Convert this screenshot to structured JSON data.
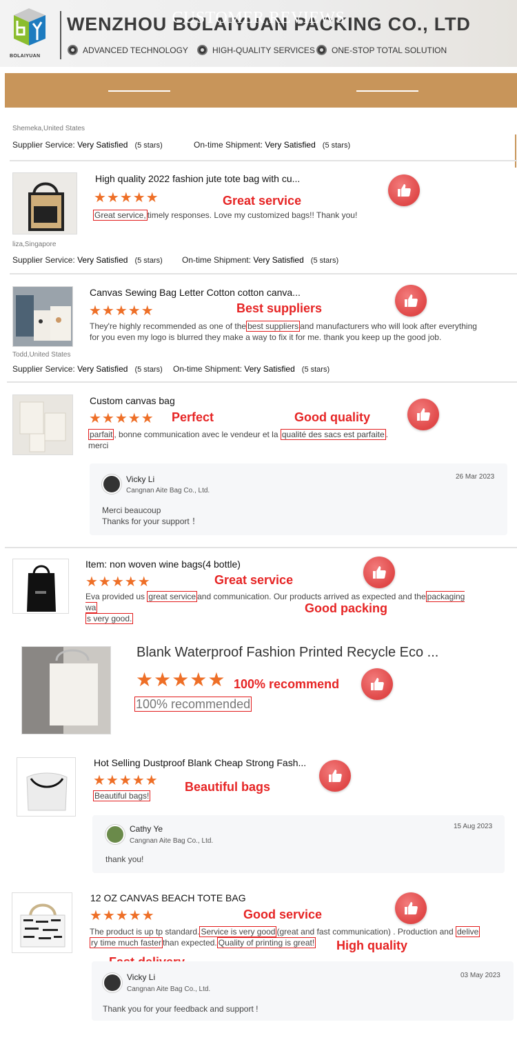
{
  "header": {
    "company_name": "WENZHOU BOLAIYUAN PACKING CO., LTD",
    "logo_text": "BOLAIYUAN",
    "features": [
      "ADVANCED TECHNOLOGY",
      "HIGH-QUALITY SERVICES",
      "ONE-STOP TOTAL SOLUTION"
    ]
  },
  "banner": {
    "title": "CUSTOMER REVIEWS"
  },
  "colors": {
    "banner": "#c8955a",
    "star": "#ee6f27",
    "red_label": "#e62424",
    "thumb": "#e04848"
  },
  "icons": {
    "like": "thumbs-up-icon",
    "star": "star-icon",
    "avatar": "avatar"
  },
  "service_labels": {
    "supplier": "Supplier Service:",
    "ontime": "On-time Shipment:",
    "very_satisfied": "Very Satisfied",
    "five_stars": "(5 stars)"
  },
  "review0": {
    "reviewer": "Shemeka,United States"
  },
  "review1": {
    "title": "High quality 2022 fashion jute tote bag with cu...",
    "stars": "★★★★★",
    "label": "Great service",
    "hl": "Great service,",
    "text_rest": "timely responses. Love my customized bags!! Thank you!",
    "reviewer": "liza,Singapore"
  },
  "review2": {
    "title": "Canvas Sewing Bag Letter Cotton cotton canva...",
    "stars": "★★★★★",
    "label": "Best suppliers",
    "text_pre": "They're highly recommended as one of the",
    "hl": "best suppliers",
    "text_post": "and manufacturers who will look after everything",
    "text_line2": "for you even my logo is blurred they make a way to fix it for me. thank you keep up the good job.",
    "reviewer": "Todd,United States"
  },
  "review3": {
    "title": "Custom canvas bag",
    "stars": "★★★★★",
    "label1": "Perfect",
    "label2": "Good quality",
    "hl1": "parfait",
    "text_mid": ", bonne communication  avec le vendeur et la",
    "hl2": "qualité des sacs  est parfaite",
    "text_end": ".",
    "text_line2": "merci",
    "reply": {
      "name": "Vicky Li",
      "company": "Cangnan Aite Bag Co., Ltd.",
      "date": "26 Mar 2023",
      "line1": "Merci  beaucoup",
      "line2": "Thanks for your support  ！"
    }
  },
  "review4": {
    "title": "Item: non woven wine bags(4 bottle)",
    "stars": "★★★★★",
    "label1": "Great service",
    "label2": "Good packing",
    "text_pre": "Eva provided us",
    "hl1": "great service",
    "text_mid": "and communication. Our products arrived as expected and the",
    "hl2a": "packaging wa",
    "hl2b": "s very good."
  },
  "review5": {
    "title": "Blank Waterproof Fashion Printed Recycle Eco ...",
    "stars": "★★★★★",
    "label": "100% recommend",
    "hl": "100% recommended"
  },
  "review6": {
    "title": "Hot Selling Dustproof Blank Cheap Strong Fash...",
    "stars": "★★★★★",
    "label": "Beautiful bags",
    "hl": "Beautiful bags!",
    "reply": {
      "name": "Cathy Ye",
      "company": "Cangnan Aite Bag Co., Ltd.",
      "date": "15 Aug 2023",
      "line1": "thank you!"
    }
  },
  "review7": {
    "title": "12 OZ CANVAS BEACH TOTE BAG",
    "stars": "★★★★★",
    "label1": "Good service",
    "label2": "High quality",
    "label3": "Fast delivery",
    "text_pre": "The product is up tp standard.",
    "hl1": "Service is very good",
    "text_mid": "(great and fast communication) . Production and",
    "hl2a": "delive",
    "hl2b": "ry time much faster",
    "text_mid2": "than expected.",
    "hl3": "Quality of printing is great!",
    "reply": {
      "name": "Vicky Li",
      "company": "Cangnan Aite Bag Co., Ltd.",
      "date": "03 May 2023",
      "line1": "Thank you for your feedback and support !"
    }
  }
}
